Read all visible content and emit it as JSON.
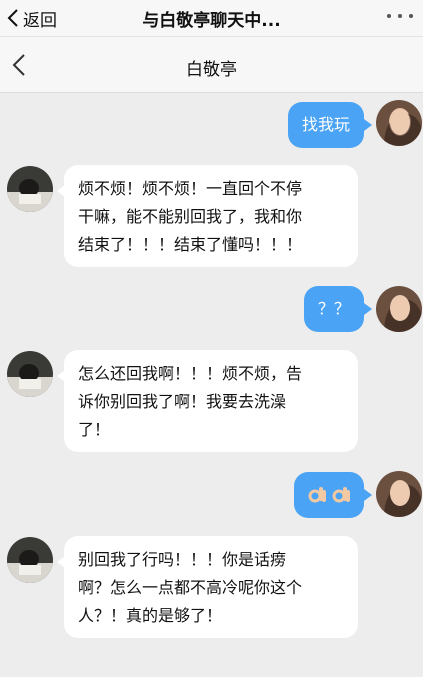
{
  "topbar": {
    "back_label": "返回",
    "title": "与白敬亭聊天中..."
  },
  "navbar": {
    "title": "白敬亭"
  },
  "messages": [
    {
      "side": "right",
      "text": "找我玩"
    },
    {
      "side": "left",
      "lines": [
        "烦不烦！烦不烦！一直回个不停",
        "干嘛，能不能别回我了，我和你",
        "结束了！！！结束了懂吗！！！"
      ]
    },
    {
      "side": "right",
      "text": "？？"
    },
    {
      "side": "left",
      "lines": [
        "怎么还回我啊！！！烦不烦，告",
        "诉你别回我了啊！我要去洗澡",
        "了！"
      ]
    },
    {
      "side": "right",
      "icon": "ok-hand-emoji-pair"
    },
    {
      "side": "left",
      "lines": [
        "别回我了行吗！！！你是话痨",
        "啊？怎么一点都不高冷呢你这个",
        "人？！真的是够了！"
      ]
    }
  ],
  "colors": {
    "accent": "#4aa3f5",
    "background": "#ededed",
    "bar": "#f7f7f7"
  }
}
